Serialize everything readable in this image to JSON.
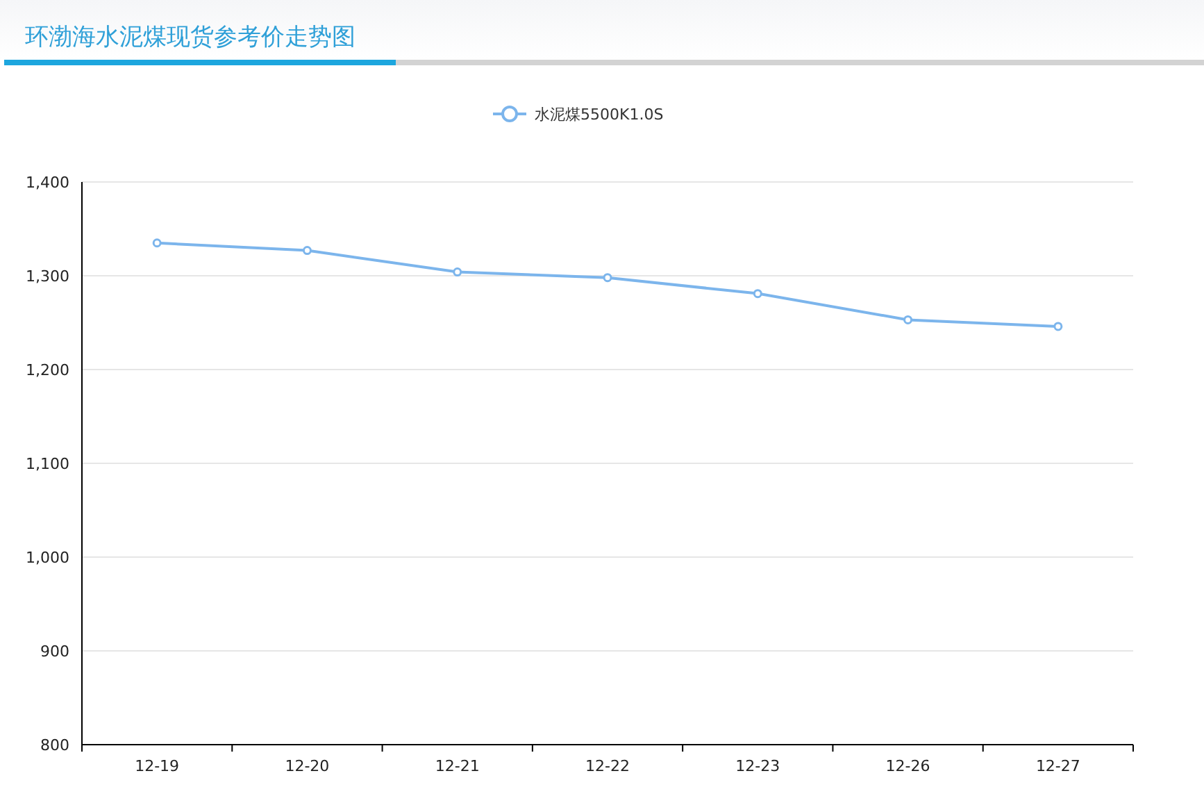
{
  "title": "环渤海水泥煤现货参考价走势图",
  "chart": {
    "chart_data": {
      "type": "line",
      "categories": [
        "12-19",
        "12-20",
        "12-21",
        "12-22",
        "12-23",
        "12-26",
        "12-27"
      ],
      "grid": true,
      "series": [
        {
          "name": "水泥煤5500K1.0S",
          "color": "#7cb5ec",
          "marker": "circle",
          "values": [
            1335,
            1327,
            1304,
            1298,
            1281,
            1253,
            1246
          ]
        }
      ],
      "ylim": [
        800,
        1400
      ],
      "yticks": [
        {
          "value": 800,
          "label": "800"
        },
        {
          "value": 900,
          "label": "900"
        },
        {
          "value": 1000,
          "label": "1,000"
        },
        {
          "value": 1100,
          "label": "1,100"
        },
        {
          "value": 1200,
          "label": "1,200"
        },
        {
          "value": 1300,
          "label": "1,300"
        },
        {
          "value": 1400,
          "label": "1,400"
        }
      ]
    }
  }
}
